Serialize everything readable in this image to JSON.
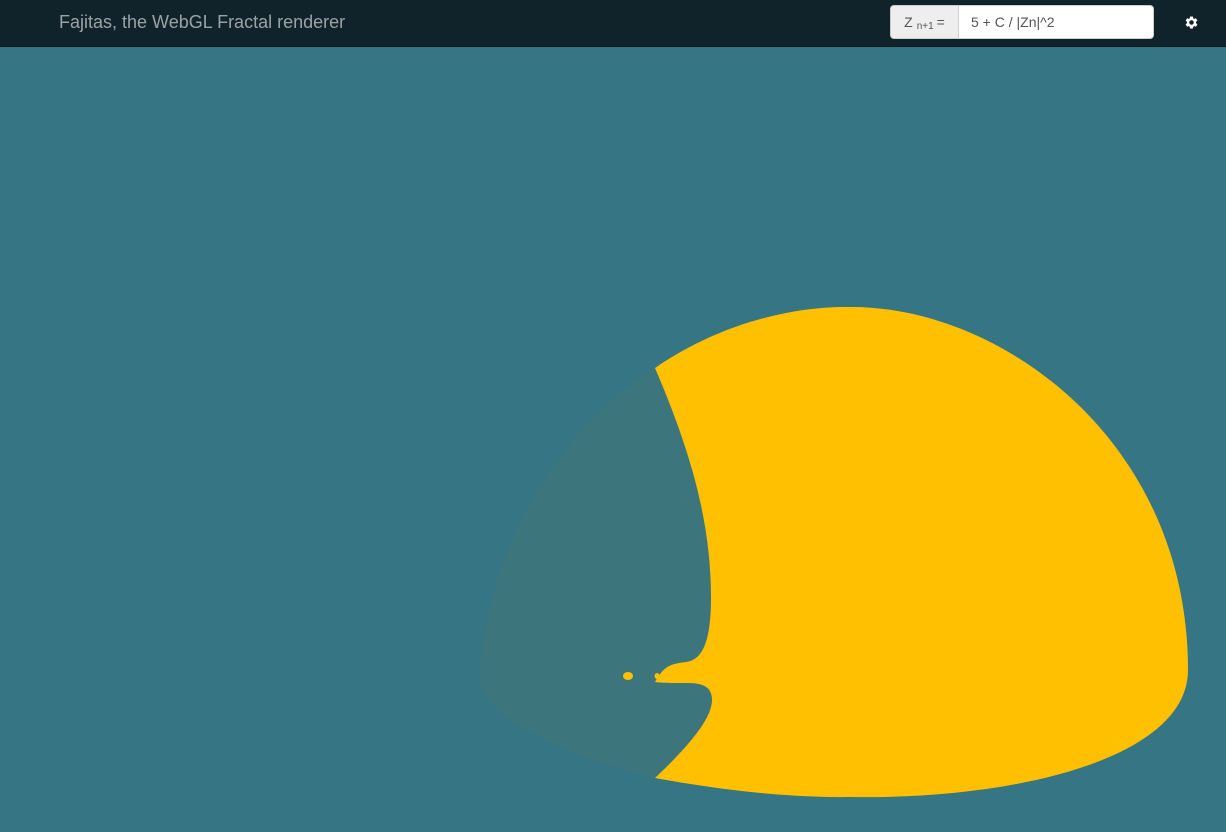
{
  "app": {
    "title": "Fajitas, the WebGL Fractal renderer"
  },
  "formula": {
    "prefix": "Z",
    "subscript": "n+1",
    "equals": "=",
    "value": "5 + C / |Zn|^2"
  },
  "settings": {
    "icon": "gear-icon"
  },
  "colors": {
    "navbar": "#10232a",
    "background": "#367584",
    "fractal_fill": "#ffc002",
    "fractal_shade": "#3d757d"
  }
}
